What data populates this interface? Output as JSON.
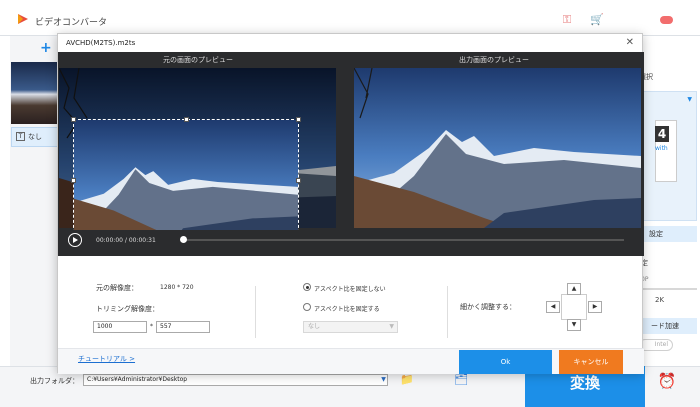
{
  "app": {
    "title": "ビデオコンバータ",
    "subtitle_tab": "なし",
    "right_panel": {
      "section_label": "選択",
      "card_number": "4",
      "card_text": "with",
      "settings_button": "設定",
      "quality_label": "定",
      "quality_value": "2K",
      "quality_low": "0P",
      "accel_button": "ード加速",
      "toggle_label": "Intel"
    },
    "output_folder_label": "出力フォルダ：",
    "output_folder_path": "C:¥Users¥Administrator¥Desktop",
    "convert_button": "変換"
  },
  "dialog": {
    "title": "AVCHD(M2TS).m2ts",
    "original_preview_label": "元の画面のプレビュー",
    "output_preview_label": "出力画面のプレビュー",
    "time_current": "00:00:00",
    "time_separator": "/",
    "time_total": "00:00:31",
    "seek_position": 0,
    "original_resolution_label": "元の解像度：",
    "original_resolution_value": "1280 * 720",
    "crop_resolution_label": "トリミング解像度：",
    "crop_width": "1000",
    "crop_times": "*",
    "crop_height": "557",
    "aspect_options": [
      {
        "label": "アスペクト比を固定しない",
        "selected": true
      },
      {
        "label": "アスペクト比を固定する",
        "selected": false
      }
    ],
    "aspect_select_value": "なし",
    "fine_adjust_label": "細かく調整する：",
    "tutorial_link": "チュートリアル >",
    "ok_button": "Ok",
    "cancel_button": "キャンセル"
  }
}
